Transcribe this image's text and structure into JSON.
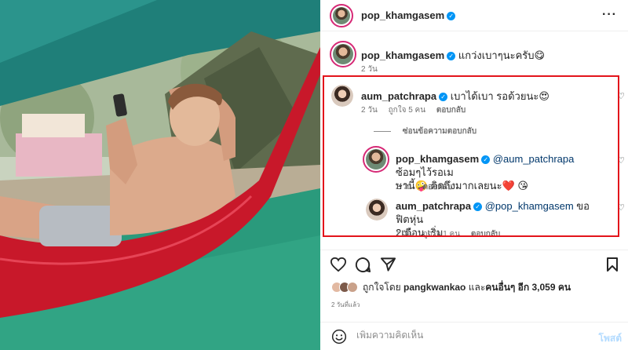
{
  "post": {
    "author": "pop_khamgasem",
    "more_icon": "more-horizontal-icon",
    "caption_user": "pop_khamgasem",
    "caption_text": "แกว่งเบาๆนะครับ😋",
    "caption_time": "2 วัน"
  },
  "comments": [
    {
      "user": "aum_patchrapa",
      "text": "เบาได้เบา รอด้วยนะ😍",
      "time": "2 วัน",
      "likes": "ถูกใจ 5 คน",
      "reply": "ตอบกลับ"
    }
  ],
  "hide_replies": "ซ่อนข้อความตอบกลับ",
  "replies": [
    {
      "user": "pop_khamgasem",
      "mention": "@aum_patchrapa",
      "text_line1": " ซ้อมๆไว้รอเม",
      "text_line2": "ษานี้🤪 คิดถึงมากเลยนะ❤️ 😘",
      "time": "2 วัน",
      "reply": "ตอบกลับ"
    },
    {
      "user": "aum_patchrapa",
      "mention": "@pop_khamgasem",
      "text_line1": " ขอฟิตหุ่น",
      "text_line2": "2เดือน เริ่ม",
      "time": "1 วัน",
      "likes": "ถูกใจ 1 คน",
      "reply": "ตอบกลับ"
    }
  ],
  "likes_row": {
    "prefix": "ถูกใจโดย ",
    "liked_by": "pangkwankao",
    "middle": " และ",
    "others": "คนอื่นๆ อีก 3,059 คน"
  },
  "time_ago": "2 วันที่แล้ว",
  "add_comment": {
    "placeholder": "เพิ่มความคิดเห็น",
    "post_label": "โพสต์"
  },
  "colors": {
    "highlight_border": "#e3141b",
    "verified": "#0095f6",
    "link": "#00376b",
    "hammock": "#c8182a",
    "mat": "#2a9a7c"
  }
}
